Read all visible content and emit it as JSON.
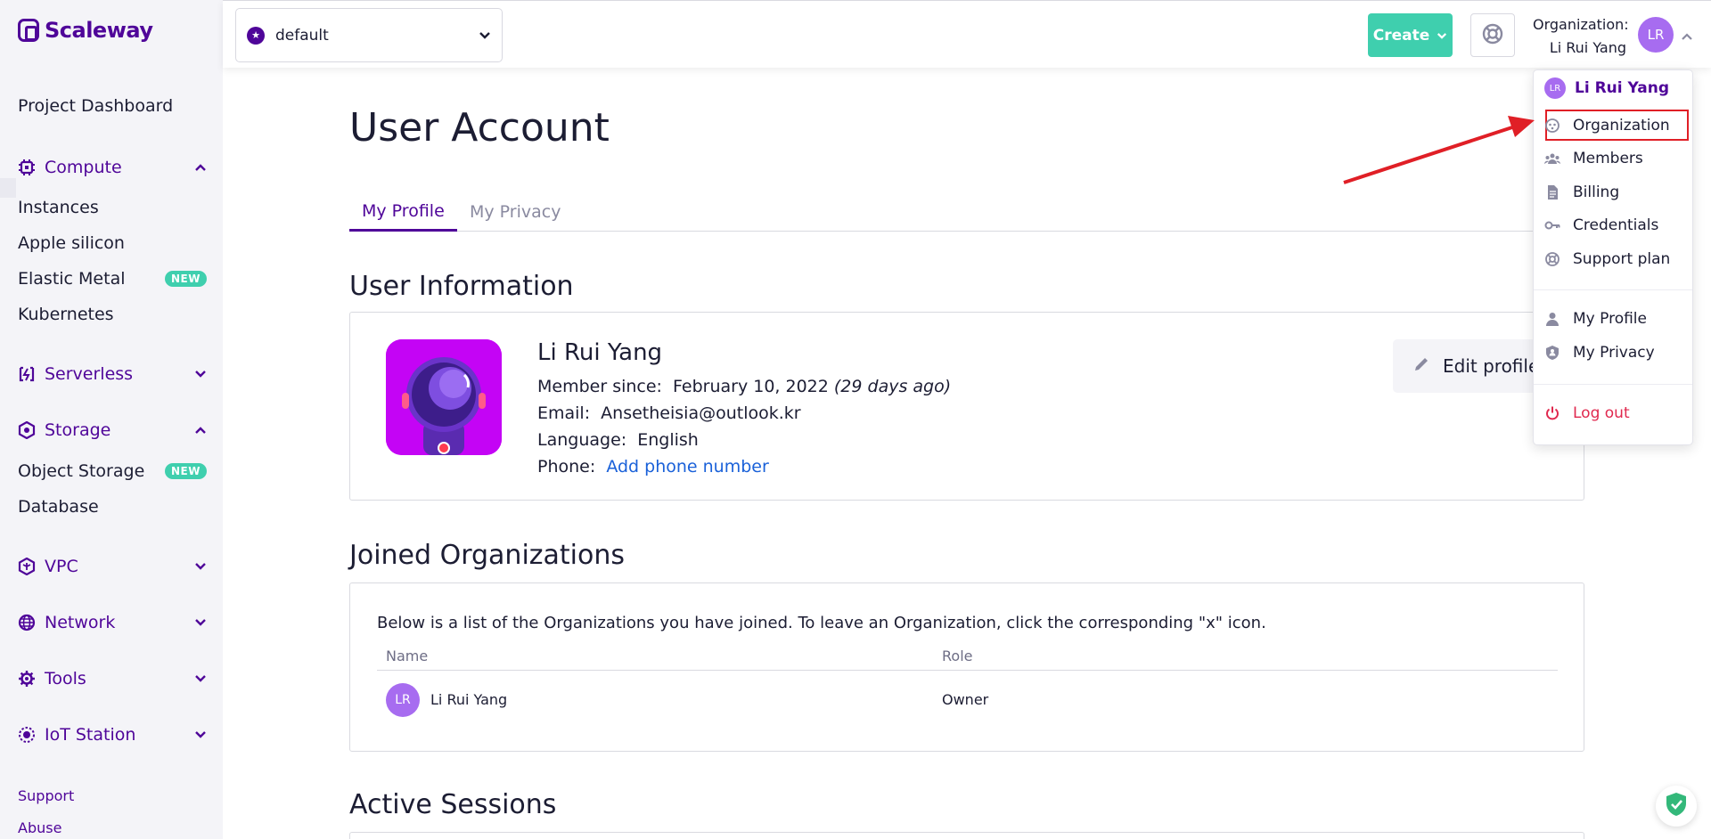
{
  "brand": {
    "name": "Scaleway"
  },
  "sidebar": {
    "top_link": "Project Dashboard",
    "sections": {
      "compute": {
        "label": "Compute",
        "items": [
          "Instances",
          "Apple silicon",
          "Elastic Metal",
          "Kubernetes"
        ]
      },
      "serverless": {
        "label": "Serverless"
      },
      "storage": {
        "label": "Storage",
        "items": [
          "Object Storage",
          "Database"
        ]
      },
      "vpc": {
        "label": "VPC"
      },
      "network": {
        "label": "Network"
      },
      "tools": {
        "label": "Tools"
      },
      "iot": {
        "label": "IoT Station"
      }
    },
    "badge_new": "NEW",
    "footer": {
      "support": "Support",
      "abuse": "Abuse"
    }
  },
  "header": {
    "project": "default",
    "create_label": "Create",
    "org_caption": "Organization:",
    "org_name": "Li Rui Yang",
    "avatar_initials": "LR"
  },
  "main": {
    "title": "User Account",
    "tabs": [
      "My Profile",
      "My Privacy"
    ],
    "user_info_title": "User Information",
    "user": {
      "name": "Li Rui Yang",
      "member_since_label": "Member since:",
      "member_since": "February 10, 2022",
      "member_since_ago": "(29 days ago)",
      "email_label": "Email:",
      "email": "Ansetheisia@outlook.kr",
      "language_label": "Language:",
      "language": "English",
      "phone_label": "Phone:",
      "phone_action": "Add phone number"
    },
    "edit_profile": "Edit profile",
    "joined_title": "Joined Organizations",
    "joined_desc": "Below is a list of the Organizations you have joined. To leave an Organization, click the corresponding \"x\" icon.",
    "table": {
      "columns": [
        "Name",
        "Role"
      ],
      "rows": [
        {
          "initials": "LR",
          "name": "Li Rui Yang",
          "role": "Owner"
        }
      ]
    },
    "sessions_title": "Active Sessions"
  },
  "dropdown": {
    "user": "Li Rui Yang",
    "user_initials": "LR",
    "items": [
      "Organization",
      "Members",
      "Billing",
      "Credentials",
      "Support plan"
    ],
    "profile_items": [
      "My Profile",
      "My Privacy"
    ],
    "logout": "Log out"
  },
  "colors": {
    "brand": "#4f0599",
    "accent": "#3fcfae",
    "link": "#1a61d9",
    "annotation": "#e01f26"
  }
}
